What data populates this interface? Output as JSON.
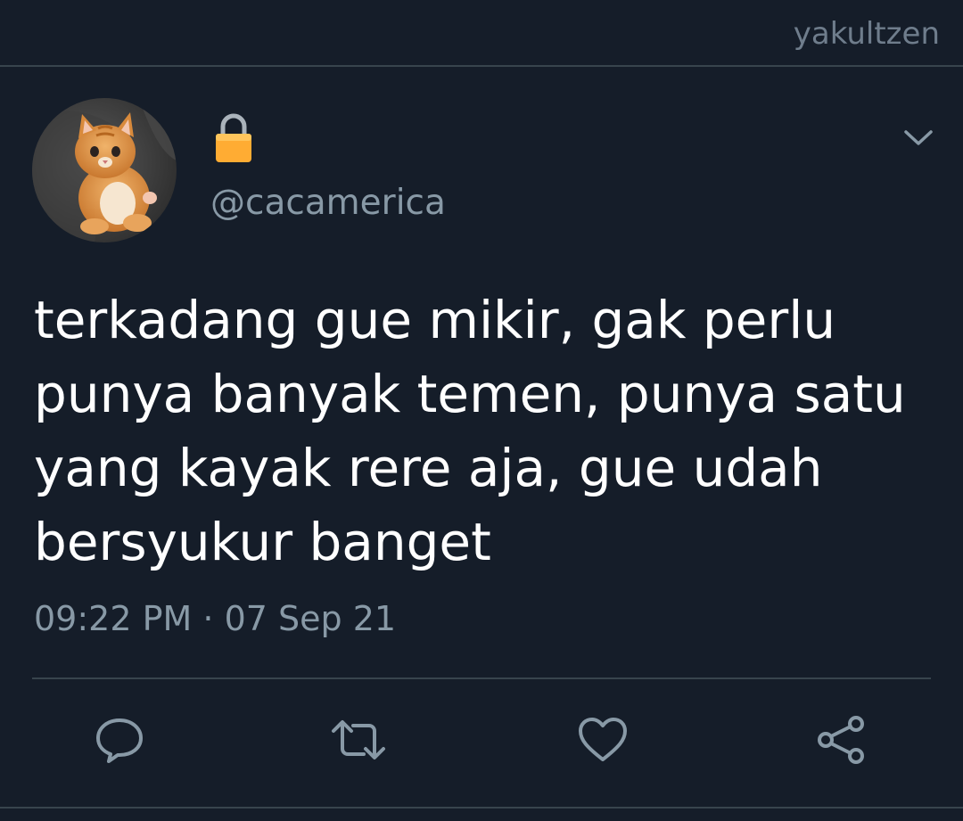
{
  "header": {
    "username": "yakultzen"
  },
  "tweet": {
    "handle": "@cacamerica",
    "lock_icon": "lock-emoji",
    "text_lines": [
      "terkadang gue mikir, gak perlu",
      "punya banyak temen, punya satu",
      "yang kayak rere aja, gue udah",
      "bersyukur banget"
    ],
    "time": "09:22 PM",
    "separator": "·",
    "date": "07 Sep 21"
  },
  "actions": {
    "icons": [
      "reply-icon",
      "retweet-icon",
      "like-icon",
      "share-icon"
    ]
  },
  "colors": {
    "background": "#151d29",
    "text_primary": "#ffffff",
    "text_secondary": "#8899a6",
    "divider": "#38444d"
  }
}
